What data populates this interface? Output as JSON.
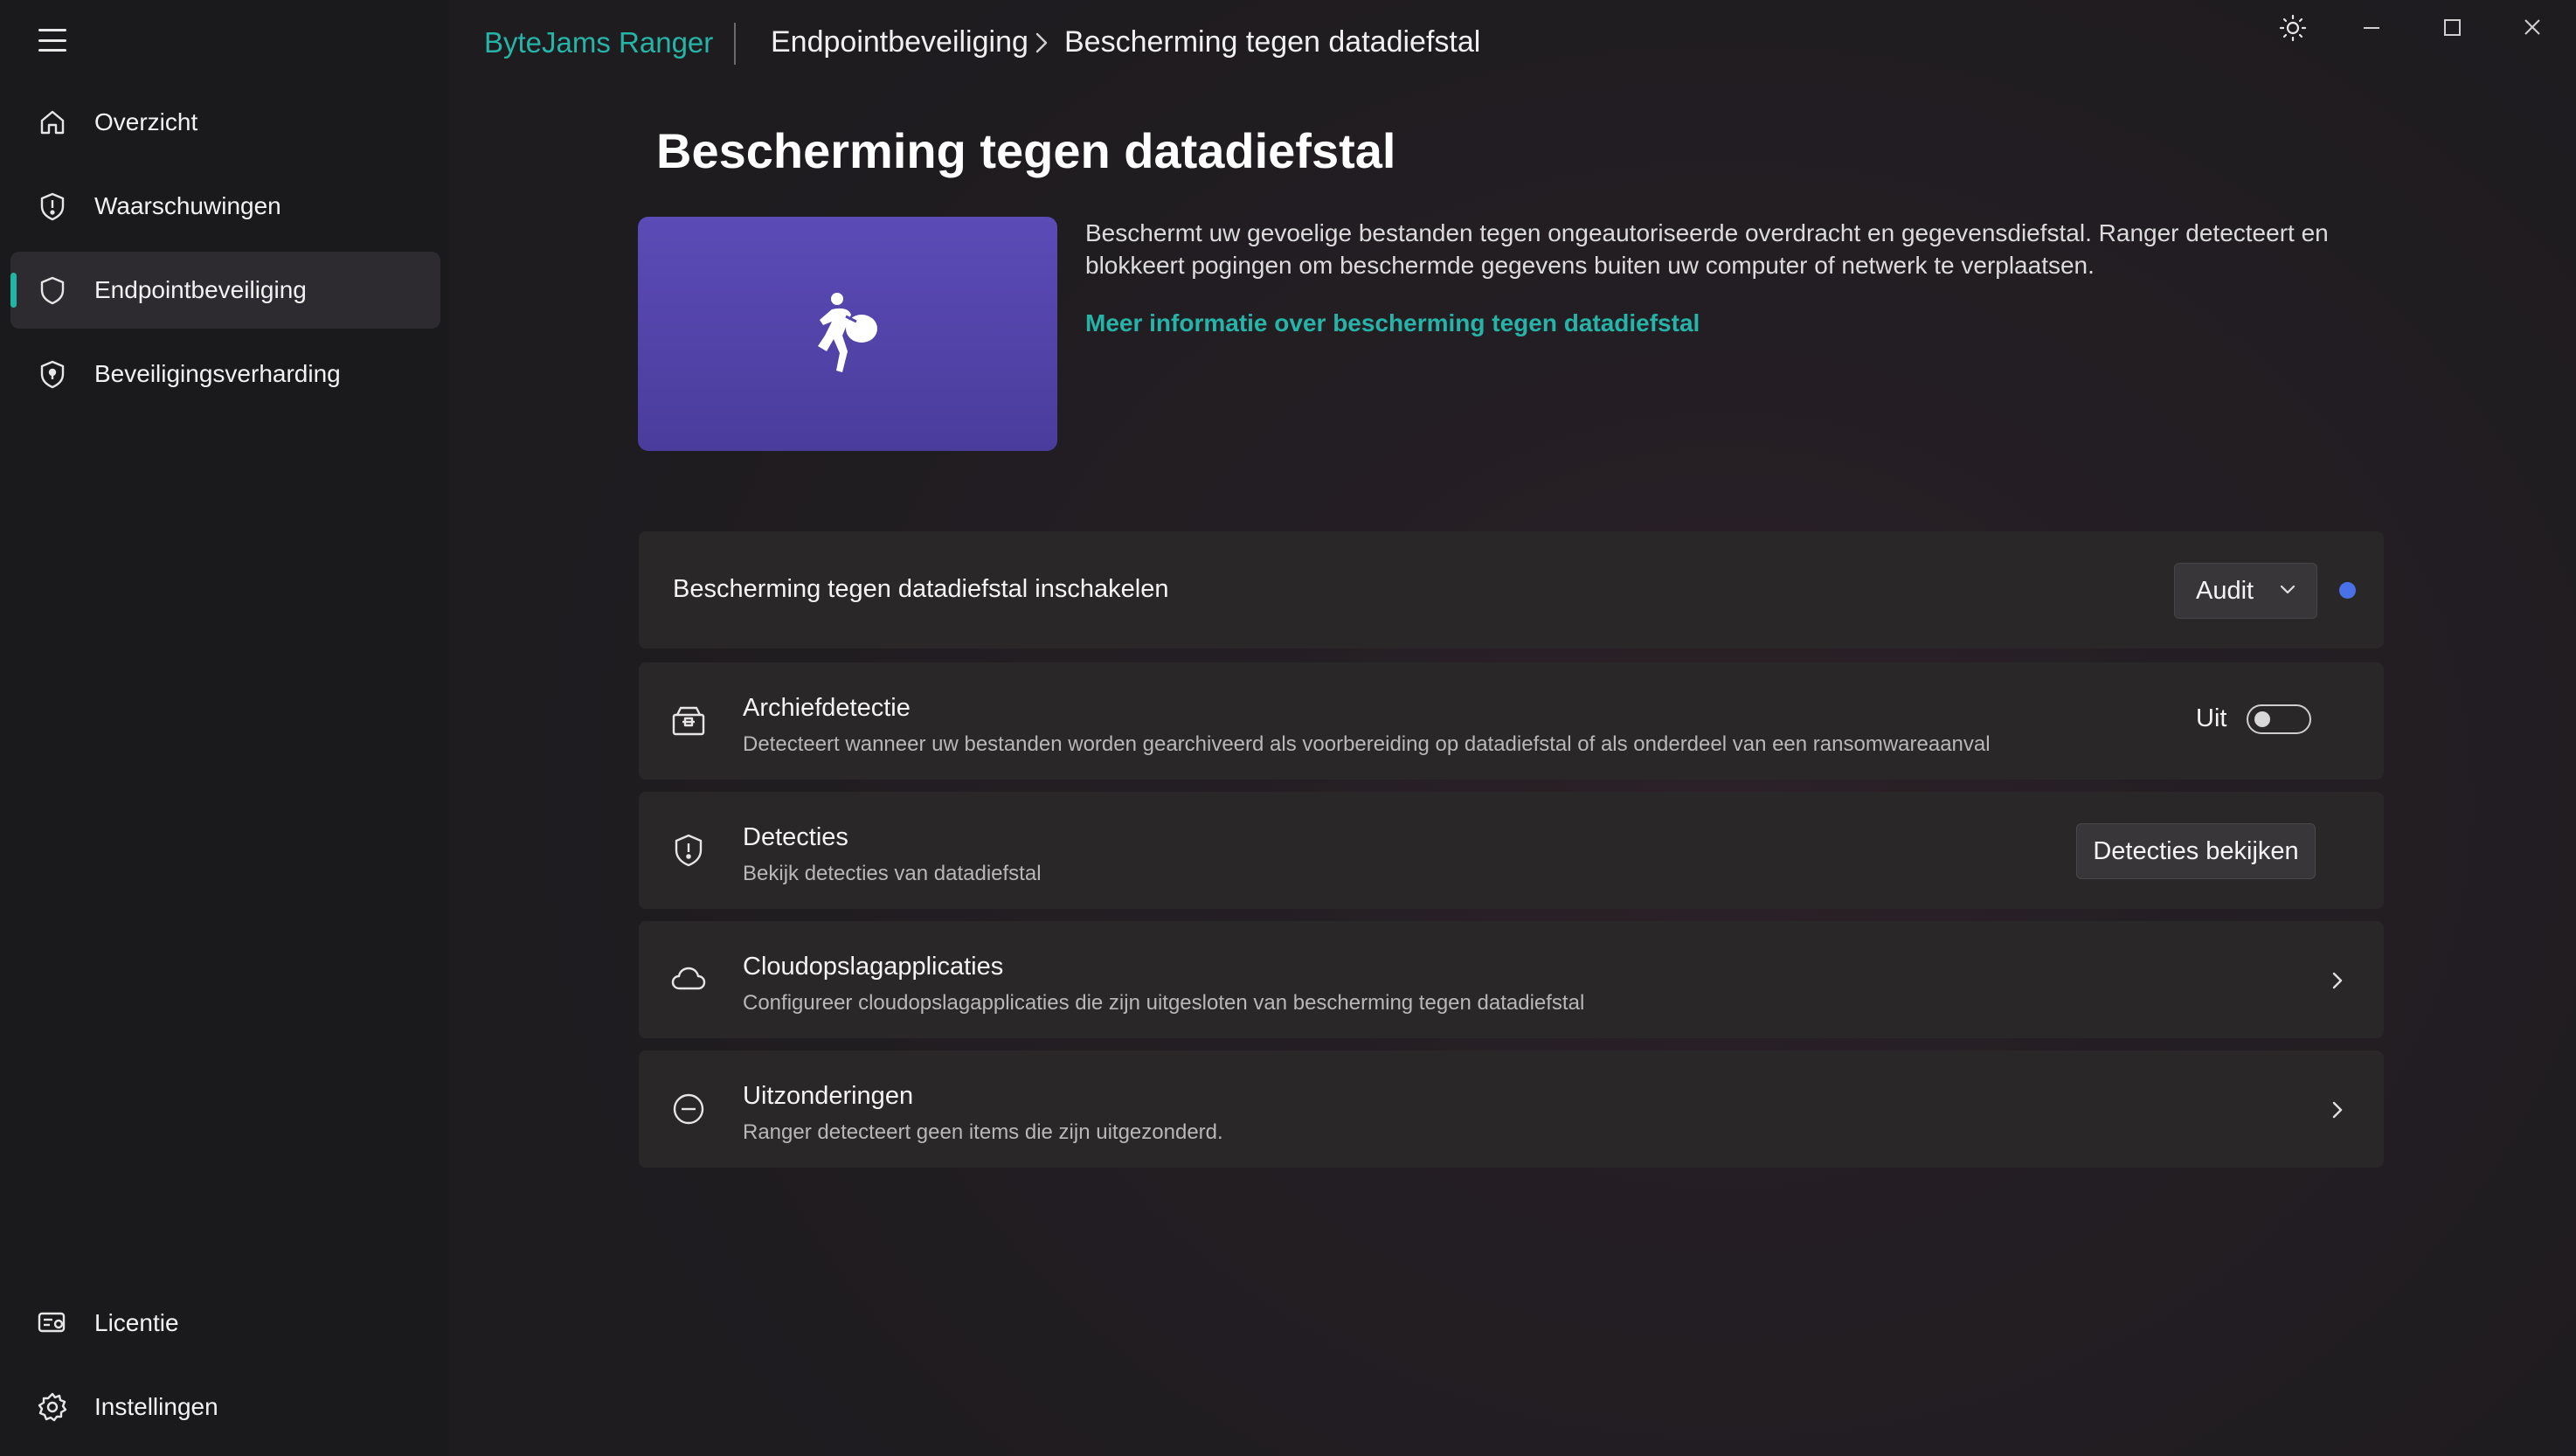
{
  "app": {
    "name": "ByteJams Ranger",
    "breadcrumb": [
      "Endpointbeveiliging",
      "Bescherming tegen datadiefstal"
    ]
  },
  "sidebar": {
    "items": [
      {
        "label": "Overzicht",
        "icon": "home-icon",
        "active": false
      },
      {
        "label": "Waarschuwingen",
        "icon": "shield-alert-icon",
        "active": false
      },
      {
        "label": "Endpointbeveiliging",
        "icon": "shield-icon",
        "active": true
      },
      {
        "label": "Beveiligingsverharding",
        "icon": "shield-lock-icon",
        "active": false
      }
    ],
    "bottom": [
      {
        "label": "Licentie",
        "icon": "license-icon"
      },
      {
        "label": "Instellingen",
        "icon": "gear-icon"
      }
    ]
  },
  "main": {
    "title": "Bescherming tegen datadiefstal",
    "description": "Beschermt uw gevoelige bestanden tegen ongeautoriseerde overdracht en gegevensdiefstal. Ranger detecteert en blokkeert pogingen om beschermde gegevens buiten uw computer of netwerk te verplaatsen.",
    "learn_more": "Meer informatie over bescherming tegen datadiefstal",
    "enable_row": {
      "label": "Bescherming tegen datadiefstal inschakelen",
      "mode": "Audit",
      "status_color": "#4a72e8"
    },
    "archive_row": {
      "title": "Archiefdetectie",
      "subtitle": "Detecteert wanneer uw bestanden worden gearchiveerd als voorbereiding op datadiefstal of als onderdeel van een ransomwareaanval",
      "toggle_label": "Uit",
      "toggle_on": false
    },
    "detections_row": {
      "title": "Detecties",
      "subtitle": "Bekijk detecties van datadiefstal",
      "button": "Detecties bekijken"
    },
    "cloud_row": {
      "title": "Cloudopslagapplicaties",
      "subtitle": "Configureer cloudopslagapplicaties die zijn uitgesloten van bescherming tegen datadiefstal"
    },
    "exceptions_row": {
      "title": "Uitzonderingen",
      "subtitle": "Ranger detecteert geen items die zijn uitgezonderd."
    }
  },
  "colors": {
    "accent": "#27b4a8",
    "hero": "#5447ad",
    "status_dot": "#4a72e8"
  }
}
